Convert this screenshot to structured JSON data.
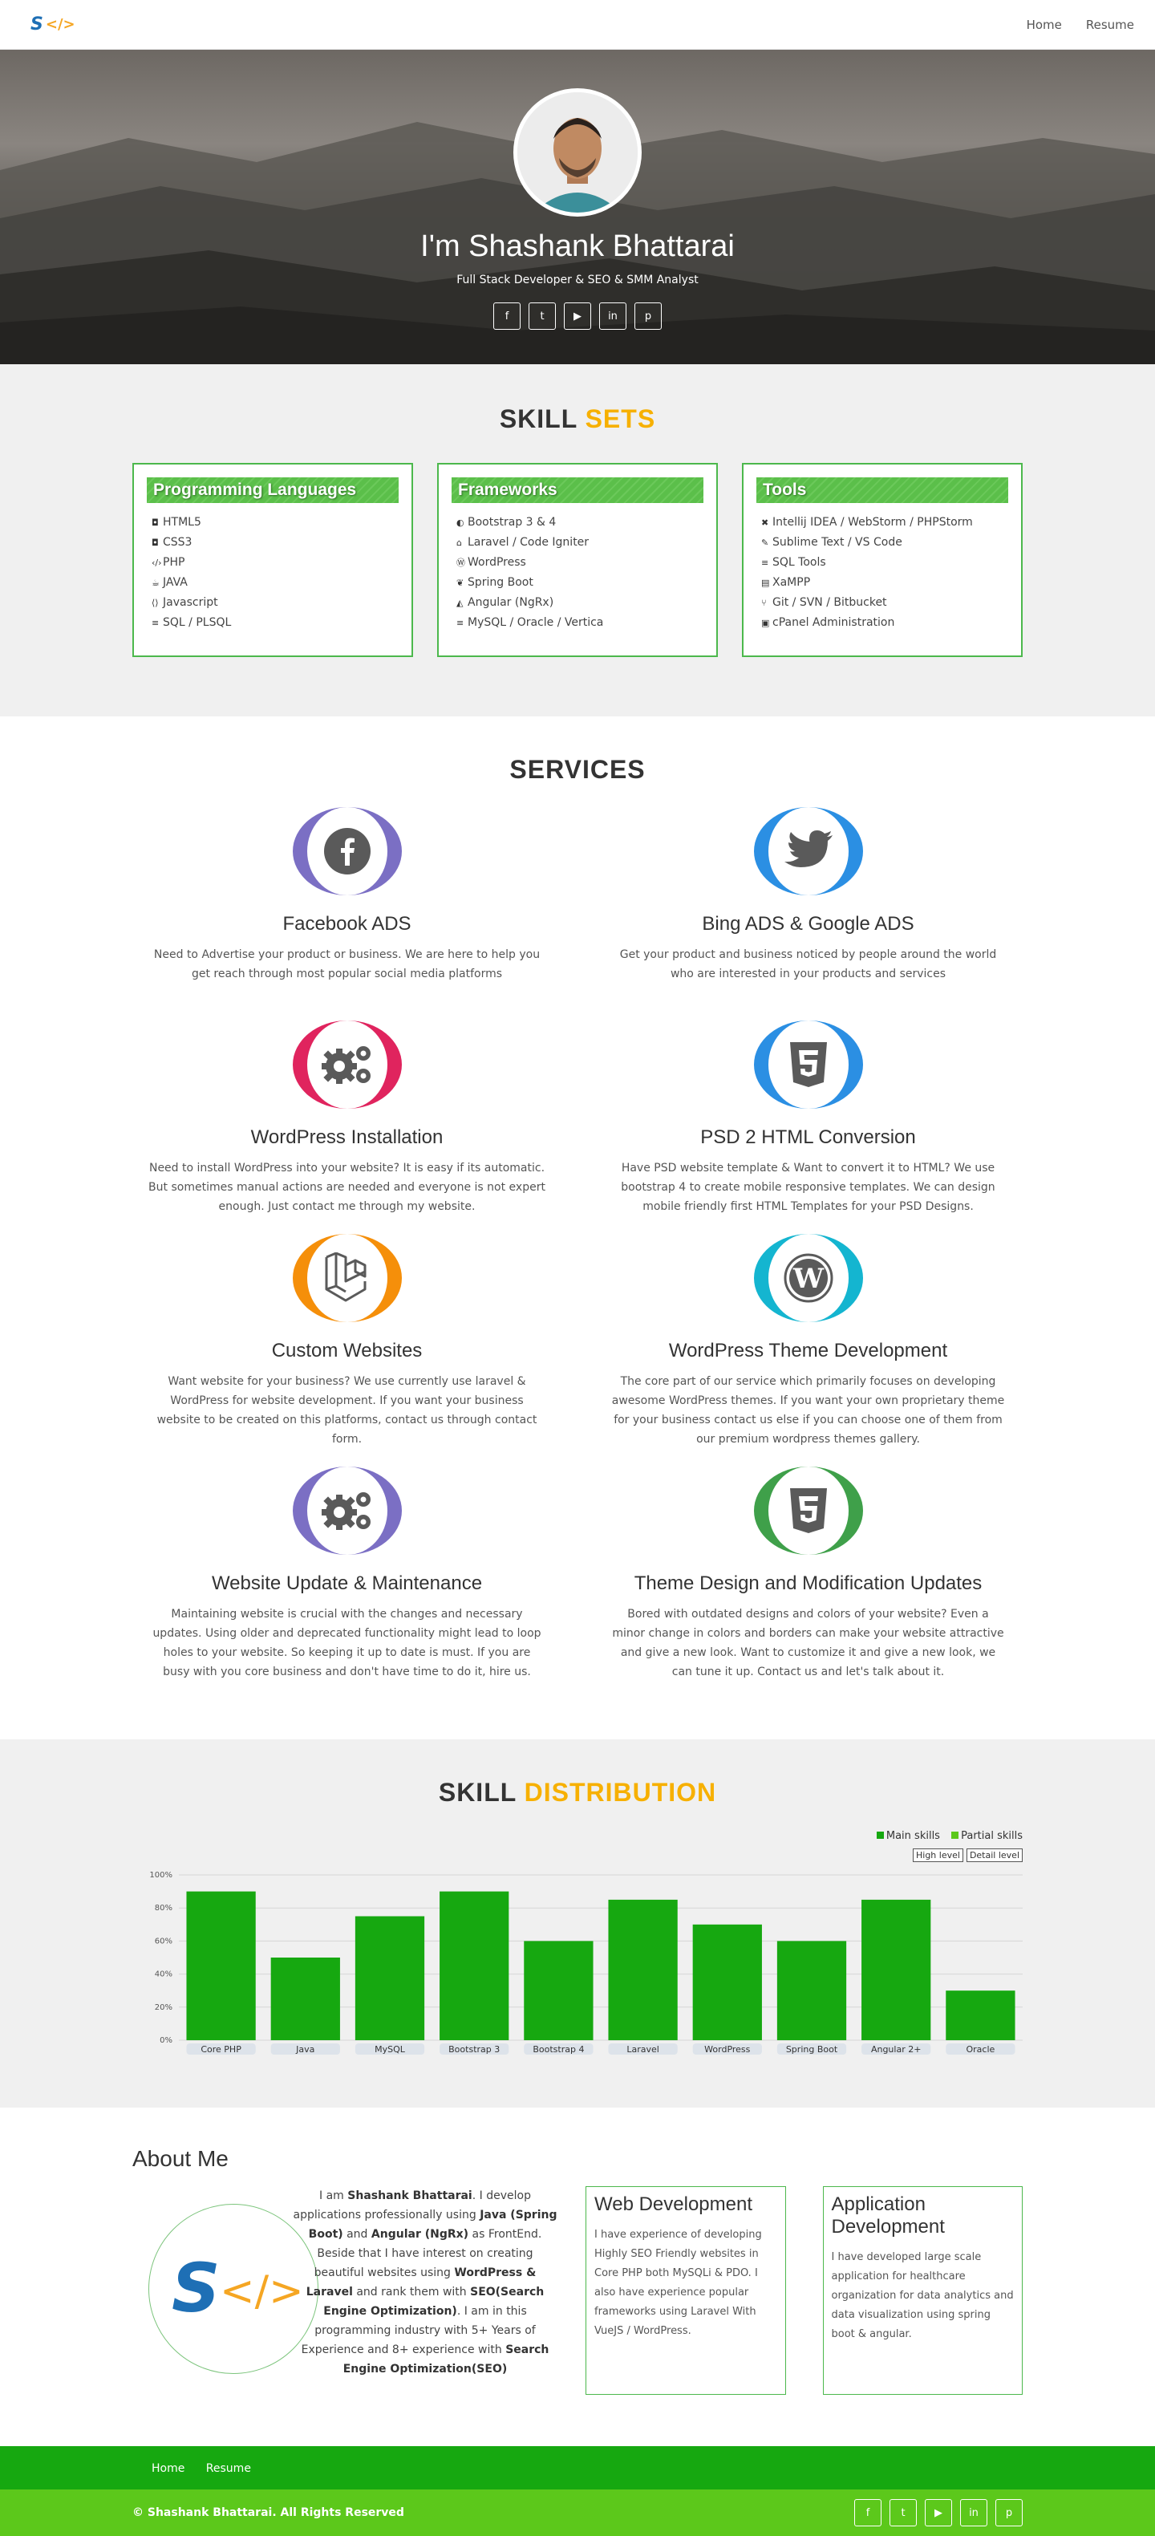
{
  "nav": {
    "links": [
      "Home",
      "Resume"
    ]
  },
  "hero": {
    "title": "I'm Shashank Bhattarai",
    "subtitle": "Full Stack Developer & SEO & SMM Analyst",
    "social_icons": [
      "facebook-icon",
      "twitter-icon",
      "youtube-icon",
      "linkedin-icon",
      "pinterest-icon"
    ]
  },
  "skills": {
    "title": "SKILL",
    "title_accent": "SETS",
    "cards": [
      {
        "title": "Programming Languages",
        "items": [
          "HTML5",
          "CSS3",
          "PHP",
          "JAVA",
          "Javascript",
          "SQL / PLSQL"
        ]
      },
      {
        "title": "Frameworks",
        "items": [
          "Bootstrap 3 & 4",
          "Laravel / Code Igniter",
          "WordPress",
          "Spring Boot",
          "Angular (NgRx)",
          "MySQL / Oracle / Vertica"
        ]
      },
      {
        "title": "Tools",
        "items": [
          "Intellij IDEA / WebStorm / PHPStorm",
          "Sublime Text / VS Code",
          "SQL Tools",
          "XaMPP",
          "Git / SVN / Bitbucket",
          "cPanel Administration"
        ]
      }
    ]
  },
  "services": {
    "title": "SERVICES",
    "items": [
      {
        "title": "Facebook ADS",
        "text": "Need to Advertise your product or business. We are here to help you get reach through most popular social media platforms",
        "color": "#7b6fc4"
      },
      {
        "title": "Bing ADS & Google ADS",
        "text": "Get your product and business noticed by people around the world who are interested in your products and services",
        "color": "#2b8fe3"
      },
      {
        "title": "WordPress Installation",
        "text": "Need to install WordPress into your website? It is easy if its automatic. But sometimes manual actions are needed and everyone is not expert enough. Just contact me through my website.",
        "color": "#e0245e"
      },
      {
        "title": "PSD 2 HTML Conversion",
        "text": "Have PSD website template & Want to convert it to HTML? We use bootstrap 4 to create mobile responsive templates. We can design mobile friendly first HTML Templates for your PSD Designs.",
        "color": "#2b8fe3"
      },
      {
        "title": "Custom Websites",
        "text": "Want website for your business? We use currently use laravel & WordPress for website development. If you want your business website to be created on this platforms, contact us through contact form.",
        "color": "#f58f0a"
      },
      {
        "title": "WordPress Theme Development",
        "text": "The core part of our service which primarily focuses on developing awesome WordPress themes. If you want your own proprietary theme for your business contact us else if you can choose one of them from our premium wordpress themes gallery.",
        "color": "#14b5d0"
      },
      {
        "title": "Website Update & Maintenance",
        "text": "Maintaining website is crucial with the changes and necessary updates. Using older and deprecated functionality might lead to loop holes to your website. So keeping it up to date is must. If you are busy with you core business and don't have time to do it, hire us.",
        "color": "#7b6fc4"
      },
      {
        "title": "Theme Design and Modification Updates",
        "text": "Bored with outdated designs and colors of your website? Even a minor change in colors and borders can make your website attractive and give a new look. Want to customize it and give a new look, we can tune it up. Contact us and let's talk about it.",
        "color": "#3fa04a"
      }
    ]
  },
  "distribution": {
    "title": "SKILL",
    "title_accent": "DISTRIBUTION",
    "legend": [
      "Main skills",
      "Partial skills"
    ],
    "legend_colors": [
      "#16a810",
      "#5cc81b"
    ],
    "buttons": [
      "High level",
      "Detail level"
    ]
  },
  "chart_data": {
    "type": "bar",
    "categories": [
      "Core PHP",
      "Java",
      "MySQL",
      "Bootstrap 3",
      "Bootstrap 4",
      "Laravel",
      "WordPress",
      "Spring Boot",
      "Angular 2+",
      "Oracle"
    ],
    "values": [
      90,
      50,
      75,
      90,
      60,
      85,
      70,
      60,
      85,
      30
    ],
    "yticks": [
      "0%",
      "20%",
      "40%",
      "60%",
      "80%",
      "100%"
    ],
    "ylim": [
      0,
      100
    ],
    "bar_color": "#16a810",
    "grid": true
  },
  "about": {
    "title": "About Me",
    "para": [
      {
        "t": "I am "
      },
      {
        "b": "Shashank Bhattarai"
      },
      {
        "t": ". I develop applications professionally using "
      },
      {
        "b": "Java (Spring Boot)"
      },
      {
        "t": " and "
      },
      {
        "b": "Angular (NgRx)"
      },
      {
        "t": " as FrontEnd. Beside that I have interest on creating beautiful websites using "
      },
      {
        "b": "WordPress & Laravel"
      },
      {
        "t": " and rank them with "
      },
      {
        "b": "SEO(Search Engine Optimization)"
      },
      {
        "t": ". I am in this programming industry with 5+ Years of Experience and 8+ experience with "
      },
      {
        "b": "Search Engine Optimization(SEO)"
      }
    ],
    "cards": [
      {
        "title": "Web Development",
        "text": "I have experience of developing Highly SEO Friendly websites in Core PHP both MySQLi & PDO. I also have experience popular frameworks using Laravel With VueJS / WordPress."
      },
      {
        "title": "Application Development",
        "text": "I have developed large scale application for healthcare organization for data analytics and data visualization using spring boot & angular."
      }
    ]
  },
  "footer": {
    "links": [
      "Home",
      "Resume"
    ],
    "copyright": "© Shashank Bhattarai. All Rights Reserved"
  }
}
